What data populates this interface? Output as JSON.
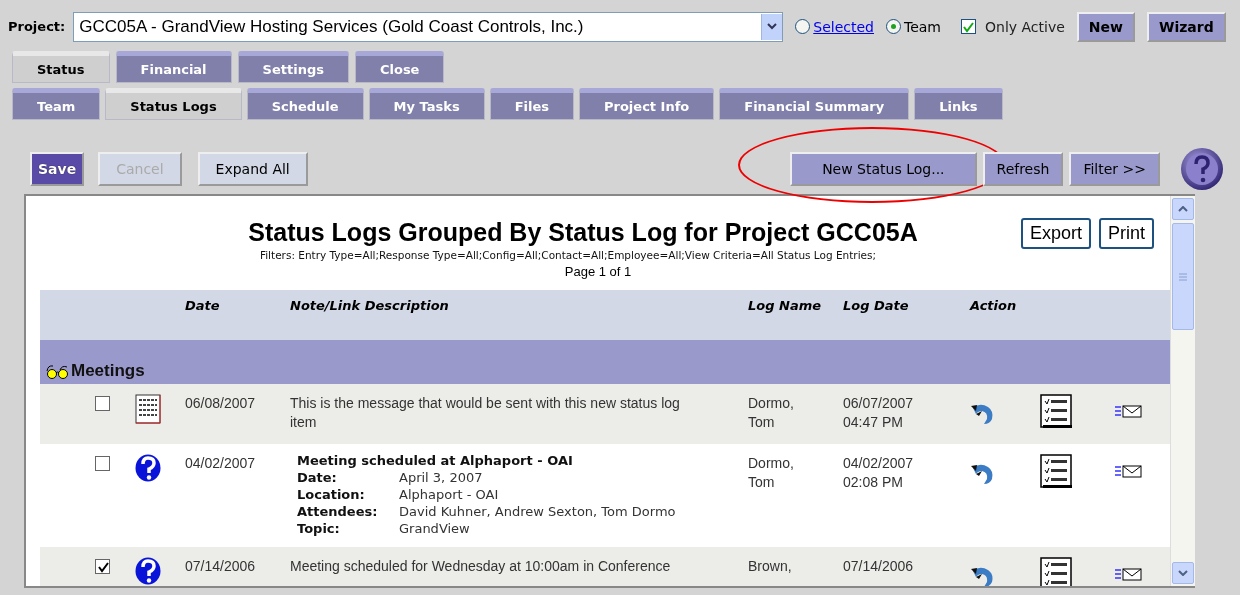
{
  "project": {
    "label": "Project:",
    "value": "GCC05A - GrandView Hosting Services (Gold Coast Controls, Inc.)"
  },
  "scope": [
    {
      "label": "Selected",
      "kind": "link",
      "selected": false
    },
    {
      "label": "Team",
      "kind": "text",
      "selected": true
    }
  ],
  "only_active": {
    "label": "Only Active",
    "checked": true
  },
  "top_buttons": [
    "New",
    "Wizard"
  ],
  "tabs": [
    {
      "label": "Status",
      "selected": true
    },
    {
      "label": "Financial",
      "selected": false
    },
    {
      "label": "Settings",
      "selected": false
    },
    {
      "label": "Close",
      "selected": false
    }
  ],
  "subtabs": [
    {
      "label": "Team",
      "selected": false
    },
    {
      "label": "Status Logs",
      "selected": true
    },
    {
      "label": "Schedule",
      "selected": false
    },
    {
      "label": "My Tasks",
      "selected": false
    },
    {
      "label": "Files",
      "selected": false
    },
    {
      "label": "Project Info",
      "selected": false
    },
    {
      "label": "Financial Summary",
      "selected": false
    },
    {
      "label": "Links",
      "selected": false
    }
  ],
  "toolbar_left": [
    {
      "label": "Save",
      "kind": "primary",
      "disabled": false
    },
    {
      "label": "Cancel",
      "kind": "plain",
      "disabled": true
    },
    {
      "label": "Expand All",
      "kind": "plain",
      "disabled": false
    }
  ],
  "toolbar_right": [
    {
      "label": "New Status Log...",
      "circled": true
    },
    {
      "label": "Refresh",
      "circled": false
    },
    {
      "label": "Filter >>",
      "circled": false
    }
  ],
  "report": {
    "title": "Status Logs Grouped By Status Log for Project GCC05A",
    "filters": "Filters: Entry Type=All;Response Type=All;Config=All;Contact=All;Employee=All;View Criteria=All  Status Log Entries;",
    "page": "Page 1 of 1",
    "buttons": [
      "Export",
      "Print"
    ]
  },
  "table": {
    "columns": [
      "Date",
      "Note/Link Description",
      "Log Name",
      "Log Date",
      "Action"
    ],
    "groups": [
      {
        "name": "Meetings",
        "rows": [
          {
            "checked": false,
            "kind": "note",
            "date": "06/08/2007",
            "description": "This is the message that would be sent with this new status log item",
            "log_name": "Dormo, Tom",
            "log_date": "06/07/2007 04:47 PM"
          },
          {
            "checked": false,
            "kind": "meeting",
            "date": "04/02/2007",
            "meeting": {
              "title": "Meeting scheduled at Alphaport - OAI",
              "fields": [
                {
                  "label": "Date:",
                  "value": "April 3, 2007"
                },
                {
                  "label": "Location:",
                  "value": "Alphaport - OAI"
                },
                {
                  "label": "Attendees:",
                  "value": "David Kuhner, Andrew Sexton, Tom Dormo"
                },
                {
                  "label": "Topic:",
                  "value": "GrandView"
                }
              ]
            },
            "log_name": "Dormo, Tom",
            "log_date": "04/02/2007 02:08 PM"
          },
          {
            "checked": true,
            "kind": "question",
            "date": "07/14/2006",
            "description": "Meeting scheduled for Wednesday at 10:00am in Conference",
            "log_name": "Brown,",
            "log_date": "07/14/2006"
          }
        ]
      }
    ]
  }
}
